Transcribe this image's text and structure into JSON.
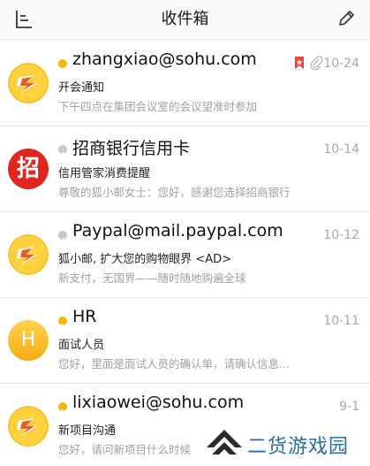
{
  "header": {
    "title": "收件箱"
  },
  "emails": [
    {
      "sender": "zhangxiao@sohu.com",
      "date": "10-24",
      "subject": "开会通知",
      "preview": "下午四点在集团会议室的会议望准时参加",
      "avatar": "sohu-fox",
      "status": "unread",
      "flagged": true,
      "has_attachment": true
    },
    {
      "sender": "招商银行信用卡",
      "date": "10-14",
      "subject": "信用管家消费提醒",
      "preview": "尊敬的狐小邮女士：您好，感谢您选择招商银行",
      "avatar_text": "招",
      "avatar": "bank-letter",
      "status": "forwarded"
    },
    {
      "sender": "Paypal@mail.paypal.com",
      "date": "10-12",
      "subject": "狐小邮, 扩大您的购物眼界 <AD>",
      "preview": "新支付，无国界——随时随地购遍全球",
      "avatar": "sohu-fox",
      "status": "forwarded"
    },
    {
      "sender": "HR",
      "date": "10-11",
      "subject": "面试人员",
      "preview": "您好，里面是面试人员的确认单，请确认信息...",
      "avatar_text": "H",
      "avatar": "letter",
      "status": "replied"
    },
    {
      "sender": "lixiaowei@sohu.com",
      "date": "9-1",
      "subject": "新项目沟通",
      "preview": "您好，请问新项目什么时候",
      "avatar": "sohu-fox",
      "status": "replied"
    }
  ],
  "watermark": {
    "text": "二货游戏园"
  },
  "colors": {
    "unread_dot": "#f5b800",
    "forwarded_dot": "#c8c8c8",
    "replied_dot": "#f5b800",
    "flag": "#e8443a",
    "bank": "#e0261e"
  }
}
